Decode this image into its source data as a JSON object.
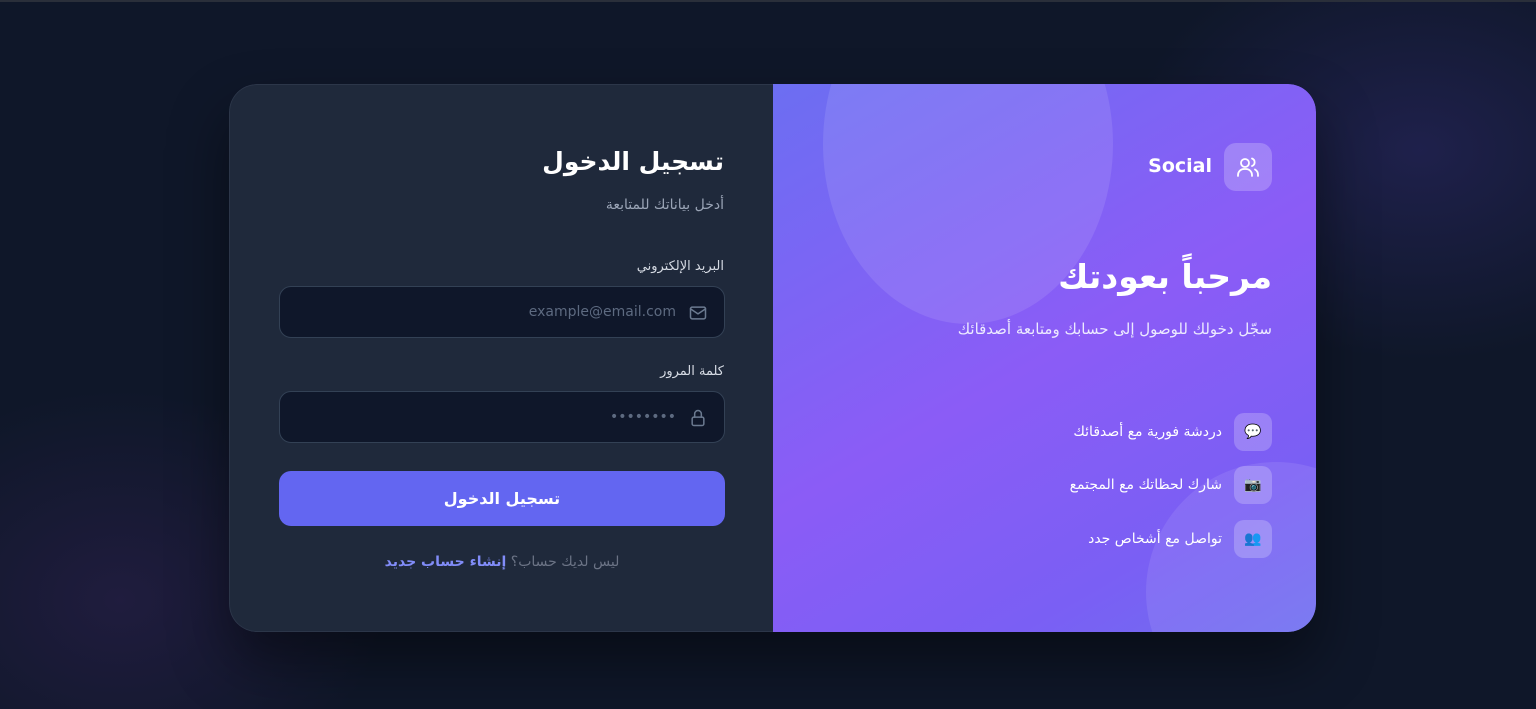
{
  "login": {
    "title": "تسجيل الدخول",
    "subtitle": "أدخل بياناتك للمتابعة",
    "email_label": "البريد الإلكتروني",
    "email_placeholder": "example@email.com",
    "email_icon": "mail-icon",
    "password_label": "كلمة المرور",
    "password_placeholder": "••••••••",
    "password_icon": "lock-icon",
    "submit_label": "تسجيل الدخول",
    "no_account_text": "ليس لديك حساب؟",
    "signup_link": "إنشاء حساب جديد"
  },
  "brand": {
    "logo_icon": "users-icon",
    "name": "Social",
    "welcome_title": "مرحباً بعودتك",
    "welcome_subtitle": "سجّل دخولك للوصول إلى حسابك ومتابعة أصدقائك",
    "features": [
      {
        "icon": "💬",
        "icon_name": "chat-bubble-icon",
        "text": "دردشة فورية مع أصدقائك"
      },
      {
        "icon": "📷",
        "icon_name": "camera-icon",
        "text": "شارك لحظاتك مع المجتمع"
      },
      {
        "icon": "👥",
        "icon_name": "people-icon",
        "text": "تواصل مع أشخاص جدد"
      }
    ]
  },
  "colors": {
    "page_bg": "#0f1729",
    "form_panel_bg": "#1f293b",
    "input_bg": "#0f172a",
    "accent": "#6366f1",
    "link": "#818cf8",
    "brand_gradient_start": "#6c6ef2",
    "brand_gradient_mid": "#8b5cf6"
  }
}
